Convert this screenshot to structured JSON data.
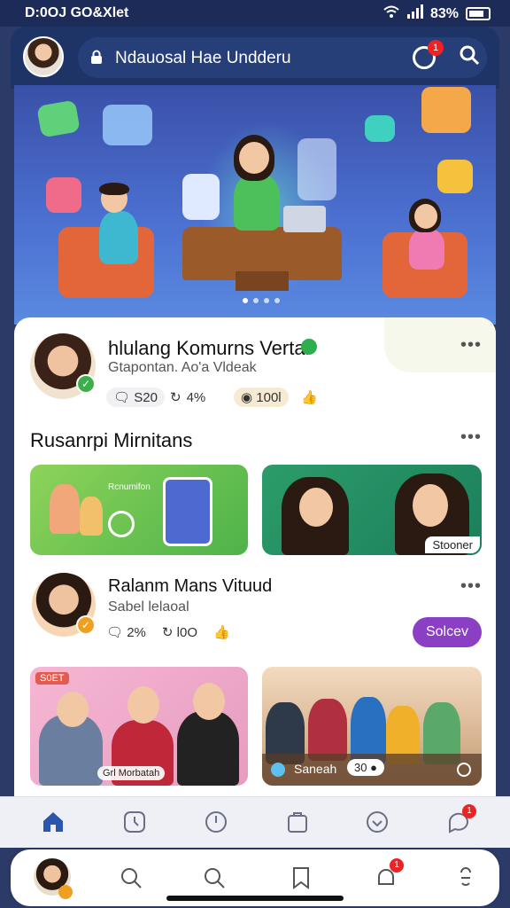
{
  "status_bar": {
    "time": "D:0OJ GO&Xlet",
    "battery": "83%"
  },
  "header": {
    "search_title": "Ndauosal Hae Undderu",
    "notification_count": "1"
  },
  "featured_profile": {
    "name": "hlulang Komurns Vertal",
    "subtitle": "Gtapontan. Ao'a Vldeak",
    "stats": {
      "comments": "S20",
      "shares": "4%",
      "coins": "100l"
    }
  },
  "section": {
    "title": "Rusanrpi Mirnitans",
    "more": "•••"
  },
  "media_cards": [
    {
      "label": "Rcnumifon"
    },
    {
      "tag": "Stooner"
    }
  ],
  "second_profile": {
    "name": "Ralanm Mans Vituud",
    "subtitle": "Sabel lelaoal",
    "stats": {
      "comments": "2%",
      "shares": "l0O"
    },
    "follow_label": "Solcev"
  },
  "bottom_cards": [
    {
      "tag_top": "S0ET",
      "tag_bottom": "Grl Morbatah"
    },
    {
      "bar_label": "Saneah",
      "count": "30 ●"
    }
  ],
  "nav_bottom": {
    "notification_count": "1"
  },
  "nav_top": {
    "notification_count": "1"
  },
  "colors": {
    "brand": "#1f3466",
    "accent": "#8a3fc4",
    "verified": "#3bb04a",
    "alert": "#e22222"
  }
}
